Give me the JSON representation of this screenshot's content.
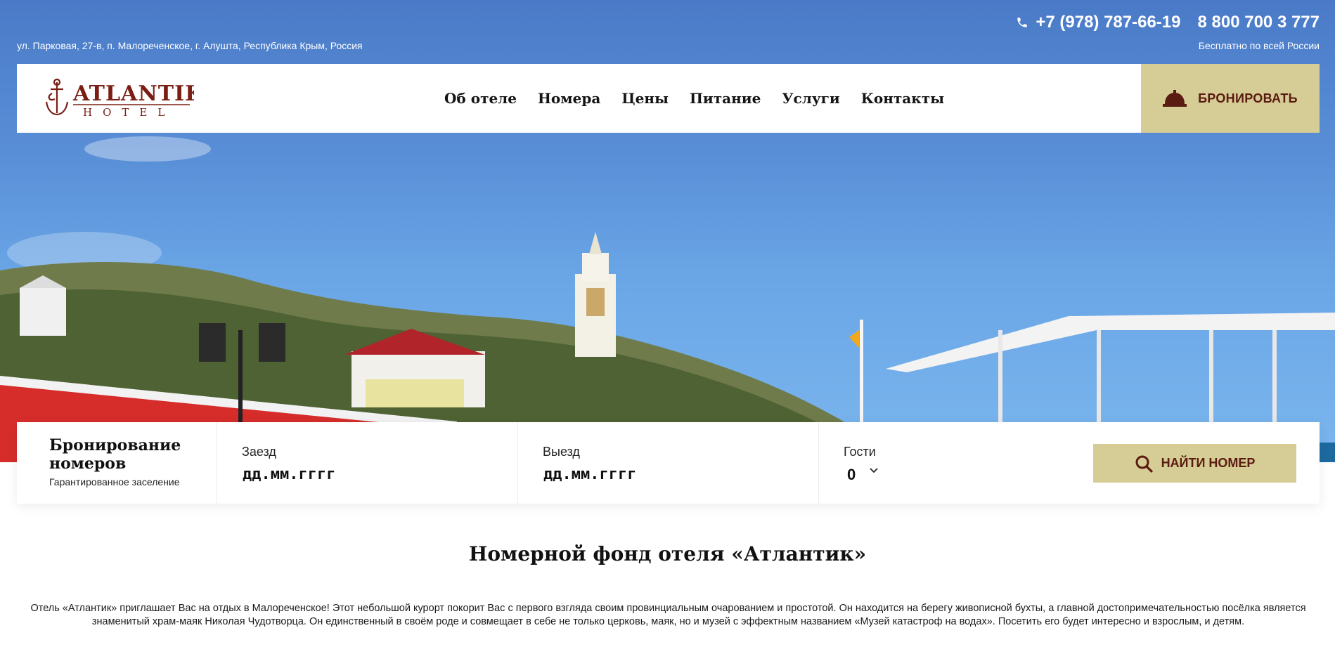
{
  "header": {
    "address": "ул. Парковая, 27-в, п. Малореченское, г. Алушта, Республика Крым, Россия",
    "phone_main": "+7 (978) 787-66-19",
    "phone_free": "8 800 700 3 777",
    "free_note": "Бесплатно по всей России",
    "phone_icon": "phone-icon"
  },
  "logo": {
    "word": "ATLANTIK",
    "sub": "HOTEL",
    "icon": "anchor-icon"
  },
  "menu": [
    {
      "label": "Об отеле"
    },
    {
      "label": "Номера"
    },
    {
      "label": "Цены"
    },
    {
      "label": "Питание"
    },
    {
      "label": "Услуги"
    },
    {
      "label": "Контакты"
    }
  ],
  "book_button": {
    "label": "БРОНИРОВАТЬ",
    "icon": "bell-icon"
  },
  "booking": {
    "title": "Бронирование номеров",
    "subtitle": "Гарантированное заселение",
    "checkin_label": "Заезд",
    "checkin_placeholder": "дд.мм.гггг",
    "checkout_label": "Выезд",
    "checkout_placeholder": "дд.мм.гггг",
    "guests_label": "Гости",
    "guests_value": "0",
    "find_label": "НАЙТИ НОМЕР",
    "find_icon": "search-icon"
  },
  "content": {
    "title": "Номерной фонд отеля «Атлантик»",
    "intro": "Отель «Атлантик» приглашает Вас на отдых в Малореченское! Этот небольшой курорт покорит Вас с первого взгляда своим провинциальным очарованием и простотой. Он находится на берегу живописной бухты, а главной достопримечательностью посёлка является знаменитый храм-маяк Николая Чудотворца. Он единственный в своём роде и совмещает в себе не только церковь, маяк, но и музей с эффектным названием «Музей катастроф на водах». Посетить его будет интересно и взрослым, и детям."
  },
  "colors": {
    "accent": "#d6cc95",
    "accent_text": "#5a1b10",
    "logo": "#7a1e14"
  }
}
